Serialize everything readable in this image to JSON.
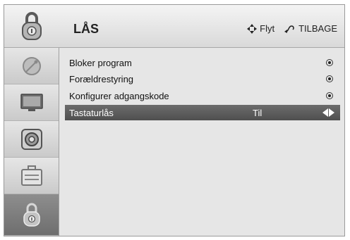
{
  "header": {
    "title": "LÅS",
    "move_label": "Flyt",
    "back_label": "TILBAGE"
  },
  "sidebar": {
    "items": [
      {
        "icon": "satellite-icon",
        "active": false
      },
      {
        "icon": "tv-icon",
        "active": false
      },
      {
        "icon": "speaker-icon",
        "active": false
      },
      {
        "icon": "toolbox-icon",
        "active": false
      },
      {
        "icon": "lock-icon",
        "active": true
      }
    ]
  },
  "menu": {
    "items": [
      {
        "label": "Bloker program",
        "value": "",
        "selected": false
      },
      {
        "label": "Forældrestyring",
        "value": "",
        "selected": false
      },
      {
        "label": "Konfigurer adgangskode",
        "value": "",
        "selected": false
      },
      {
        "label": "Tastaturlås",
        "value": "Til",
        "selected": true
      }
    ]
  }
}
